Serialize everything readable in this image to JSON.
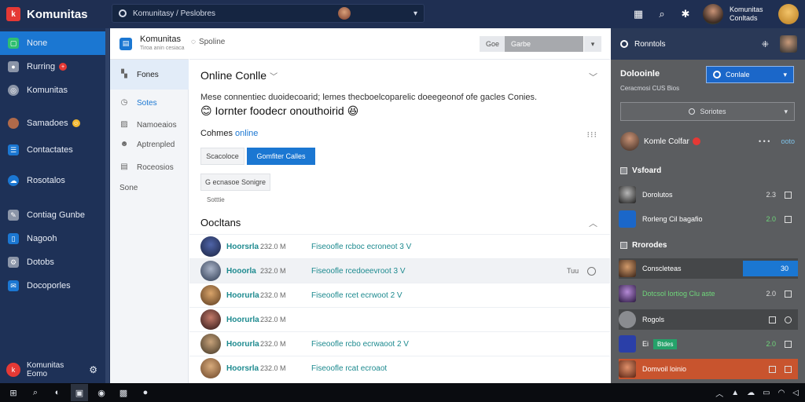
{
  "app": {
    "brand": "Komunitas",
    "search_text": "Komunitasy / Peslobres"
  },
  "topbar": {
    "user_line1": "Komunitas",
    "user_line2": "Conltads"
  },
  "leftnav": {
    "items": [
      {
        "label": "None",
        "icon": "home-icon",
        "active": true
      },
      {
        "label": "Rurring",
        "icon": "people-icon",
        "badge": "+"
      },
      {
        "label": "Komunitas",
        "icon": "globe-icon"
      },
      {
        "label": "Samadoes",
        "icon": "avatar-icon",
        "badge": "☺"
      },
      {
        "label": "Contactates",
        "icon": "contacts-icon"
      },
      {
        "label": "Rosotalos",
        "icon": "cloud-icon"
      },
      {
        "label": "Contiag Gunbe",
        "icon": "pencil-icon"
      },
      {
        "label": "Nagooh",
        "icon": "document-icon"
      },
      {
        "label": "Dotobs",
        "icon": "gear-icon"
      },
      {
        "label": "Docoporles",
        "icon": "chat-icon"
      }
    ],
    "footer_line1": "Komunitas",
    "footer_line2": "Eomo"
  },
  "subnav": {
    "title": "Komunitas",
    "subtitle": "Tiroa anin cesiaca",
    "items": [
      {
        "label": "Fones",
        "active": true
      },
      {
        "label": "Sotes"
      },
      {
        "label": "Namoeaios"
      },
      {
        "label": "Aptrenpled"
      },
      {
        "label": "Roceosios"
      },
      {
        "label": "Sone"
      }
    ]
  },
  "main": {
    "top_tab": "Spoline",
    "top_btn1": "Goe",
    "top_btn2": "Garbe",
    "online_title": "Online Conlle",
    "description": "Mese connentiec duoidecoarid; lemes thecboelcoparelic doeegeonof ofe gacles Conies.",
    "highlight": "Iornter foodecr onouthoirid",
    "comm_online_a": "Cohmes",
    "comm_online_b": "online",
    "btn_outline": "Scacoloce",
    "btn_primary": "Gomfiter Calles",
    "btn_secondary": "G ecnasoe Sonigre",
    "btn_note": "Sotttie",
    "contacts_title": "Oocltans",
    "rows": [
      {
        "name": "Hoorsrla",
        "time": "232.0 M",
        "msg": "Fiseoofle rcboc ecroneot 3 V"
      },
      {
        "name": "Hooorla",
        "time": "232.0 M",
        "msg": "Fiseoofle rcedoeevroot 3 V",
        "extra": "Tuu",
        "highlight": true
      },
      {
        "name": "Hoorurla",
        "time": "232.0 M",
        "msg": "Fiseoofle rcet ecrwoot 2 V"
      },
      {
        "name": "Hoorurla",
        "time": "232.0 M",
        "msg": ""
      },
      {
        "name": "Hoorurla",
        "time": "232.0 M",
        "msg": "Fiseoofle rcbo ecrwaoot 2 V"
      },
      {
        "name": "Hoorsrla",
        "time": "232.0 M",
        "msg": "Fiseoofle rcat ecroaot"
      }
    ]
  },
  "right": {
    "header": "Ronntols",
    "sec1_title": "Dolooinle",
    "sec1_sub": "Ceracmosi CUS Bios",
    "online_btn": "Conlale",
    "search": "Soriotes",
    "user_name": "Komle Colfar",
    "user_dots": "• • •",
    "user_link": "ooto",
    "section_a": "Vsfoard",
    "rows_a": [
      {
        "name": "Dorolutos",
        "val": "2.3"
      },
      {
        "name": "Rorleng Cil bagafio",
        "val": "2.0",
        "green": true
      }
    ],
    "section_b": "Rrorodes",
    "rows_b": [
      {
        "name": "Conscleteas",
        "val": "30",
        "blue": true
      },
      {
        "name": "Dotcsol lortiog Clu aste",
        "val": "2.0",
        "green": true
      },
      {
        "name": "Rogols",
        "val": ""
      },
      {
        "name": "Ei",
        "tag": "Btdes",
        "val": "2.0",
        "green": true
      },
      {
        "name": "Domvoil loinio",
        "val": "",
        "orange": true
      }
    ]
  },
  "colors": {
    "topbar": "#1f2f52",
    "accent": "#1b77d2",
    "contact_name": "#1d8a8f",
    "right_panel": "#5b5d60"
  }
}
